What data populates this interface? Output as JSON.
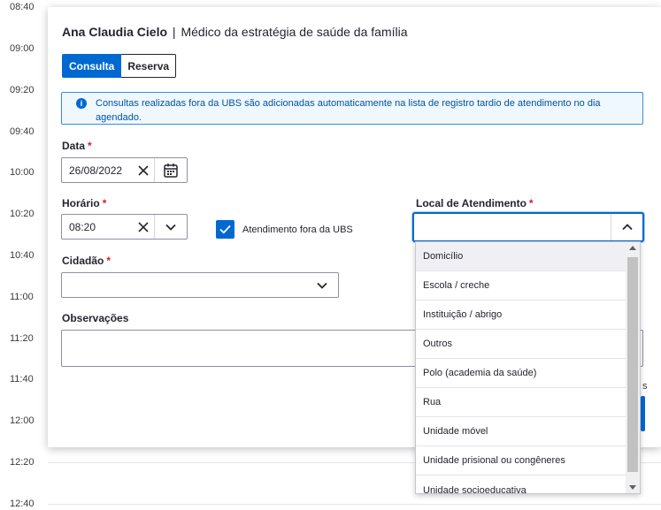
{
  "times": [
    "08:40",
    "09:00",
    "09:20",
    "09:40",
    "10:00",
    "10:20",
    "10:40",
    "11:00",
    "11:20",
    "11:40",
    "12:00",
    "12:20",
    "12:40"
  ],
  "header": {
    "name": "Ana Claudia Cielo",
    "separator": "|",
    "role": "Médico da estratégia de saúde da família"
  },
  "tabs": {
    "active": "Consulta",
    "inactive": "Reserva"
  },
  "alert": {
    "icon": "info-icon",
    "text": "Consultas realizadas fora da UBS são adicionadas automaticamente na lista de registro tardio de atendimento no dia agendado."
  },
  "form": {
    "date_label": "Data",
    "date_value": "26/08/2022",
    "time_label": "Horário",
    "time_value": "08:20",
    "outside_checkbox_label": "Atendimento fora da UBS",
    "outside_checked": true,
    "local_label": "Local de Atendimento",
    "local_value": "",
    "citizen_label": "Cidadão",
    "citizen_value": "",
    "notes_label": "Observações",
    "notes_value": "",
    "required_mark": "*"
  },
  "dropdown": {
    "options": [
      "Domicílio",
      "Escola / creche",
      "Instituição / abrigo",
      "Outros",
      "Polo (academia da saúde)",
      "Rua",
      "Unidade móvel",
      "Unidade prisional ou congêneres",
      "Unidade socioeducativa"
    ],
    "highlighted_index": 0
  },
  "truncated_right_text": "s",
  "colors": {
    "primary": "#0069d0",
    "required": "#d01e29",
    "alert_bg": "#f0f8ff",
    "alert_text": "#0051a3"
  }
}
